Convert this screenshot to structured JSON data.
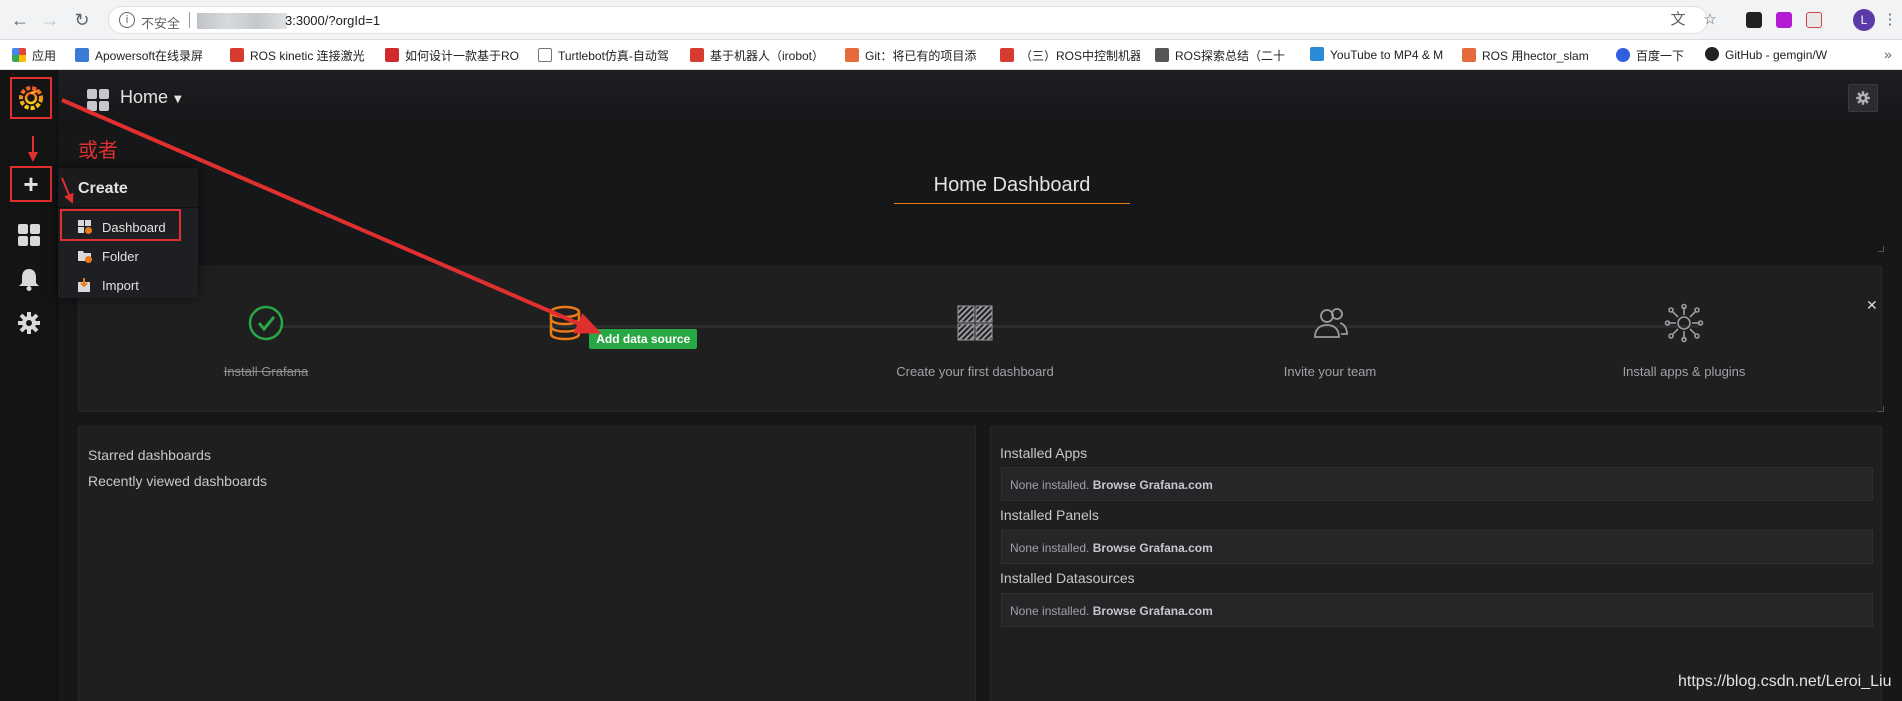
{
  "browser": {
    "secure_label": "不安全",
    "url": "3:3000/?orgId=1",
    "profile_initial": "L",
    "bookmarks": [
      {
        "label": "应用",
        "color": "#e0453a"
      },
      {
        "label": "Apowersoft在线录屏",
        "color": "#3b7bd4"
      },
      {
        "label": "ROS kinetic 连接激光",
        "color": "#d63b2f"
      },
      {
        "label": "如何设计一款基于ROS",
        "color": "#d02a2a"
      },
      {
        "label": "Turtlebot仿真-自动驾",
        "color": "#777777"
      },
      {
        "label": "基于机器人（irobot）",
        "color": "#d63b2f"
      },
      {
        "label": "Git：将已有的项目添",
        "color": "#e56b3c"
      },
      {
        "label": "（三）ROS中控制机器",
        "color": "#d63b2f"
      },
      {
        "label": "ROS探索总结（二十",
        "color": "#555555"
      },
      {
        "label": "YouTube to MP4 & M",
        "color": "#2a8bd6"
      },
      {
        "label": "ROS 用hector_slam",
        "color": "#e56b3c"
      },
      {
        "label": "百度一下",
        "color": "#2f5ee0"
      },
      {
        "label": "GitHub - gemgin/W",
        "color": "#222222"
      }
    ]
  },
  "navbar": {
    "title": "Home"
  },
  "annotation": "或者",
  "create_menu": {
    "title": "Create",
    "items": [
      {
        "label": "Dashboard",
        "icon": "dashboard-plus-icon"
      },
      {
        "label": "Folder",
        "icon": "folder-plus-icon"
      },
      {
        "label": "Import",
        "icon": "import-icon"
      }
    ]
  },
  "dashboard": {
    "title": "Home Dashboard",
    "steps": [
      {
        "label": "Install Grafana",
        "icon": "check-circle-icon",
        "state": "done"
      },
      {
        "label": "Add data source",
        "icon": "database-icon",
        "state": "active"
      },
      {
        "label": "Create your first dashboard",
        "icon": "dashboard-grid-icon",
        "state": "todo"
      },
      {
        "label": "Invite your team",
        "icon": "users-icon",
        "state": "todo"
      },
      {
        "label": "Install apps & plugins",
        "icon": "plugins-icon",
        "state": "todo"
      }
    ],
    "starred": "Starred dashboards",
    "recent": "Recently viewed dashboards",
    "installed": [
      {
        "heading": "Installed Apps",
        "none": "None installed.",
        "link": "Browse Grafana.com"
      },
      {
        "heading": "Installed Panels",
        "none": "None installed.",
        "link": "Browse Grafana.com"
      },
      {
        "heading": "Installed Datasources",
        "none": "None installed.",
        "link": "Browse Grafana.com"
      }
    ]
  },
  "watermark": "https://blog.csdn.net/Leroi_Liu",
  "colors": {
    "accent_orange": "#eb7b18",
    "annotation_red": "#e02f2f",
    "success_green": "#28a745"
  }
}
